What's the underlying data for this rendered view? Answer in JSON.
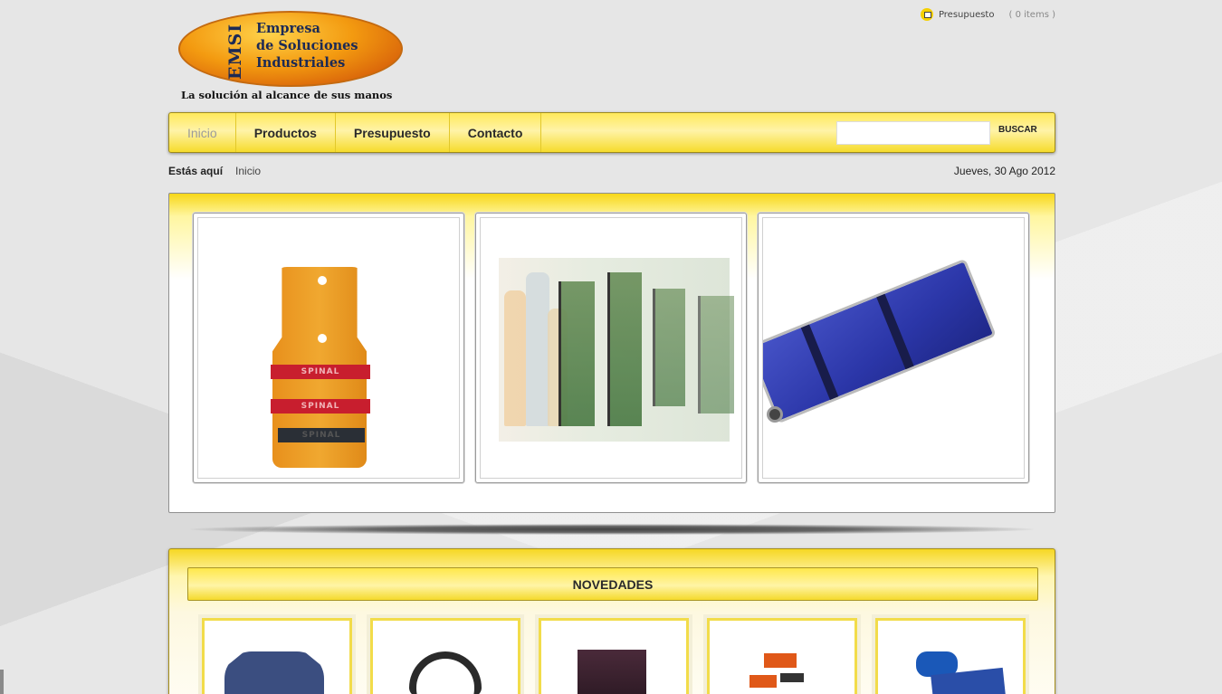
{
  "header": {
    "logo_mark": "EMSI",
    "logo_name_lines": [
      "Empresa",
      "de Soluciones",
      "Industriales"
    ],
    "tagline": "La solución al alcance de sus manos"
  },
  "cart": {
    "label": "Presupuesto",
    "count": "( 0 items )",
    "icon": "cart-icon"
  },
  "nav": {
    "items": [
      {
        "label": "Inicio",
        "active": true
      },
      {
        "label": "Productos",
        "active": false
      },
      {
        "label": "Presupuesto",
        "active": false
      },
      {
        "label": "Contacto",
        "active": false
      }
    ],
    "search_placeholder": "",
    "search_button": "BUSCAR"
  },
  "breadcrumb": {
    "label": "Estás aquí",
    "current": "Inicio"
  },
  "date": "Jueves, 30 Ago 2012",
  "slider": {
    "items": [
      "spinal-board-image",
      "splints-image",
      "stretcher-image"
    ],
    "strap_text": "SPINAL"
  },
  "novedades": {
    "title": "NOVEDADES",
    "products": [
      "shirt-image",
      "belt-image",
      "case-image",
      "sam-splint-image",
      "bag-image"
    ]
  },
  "colors": {
    "accent_yellow": "#f6dc2c",
    "nav_border": "#9d8a1c"
  }
}
